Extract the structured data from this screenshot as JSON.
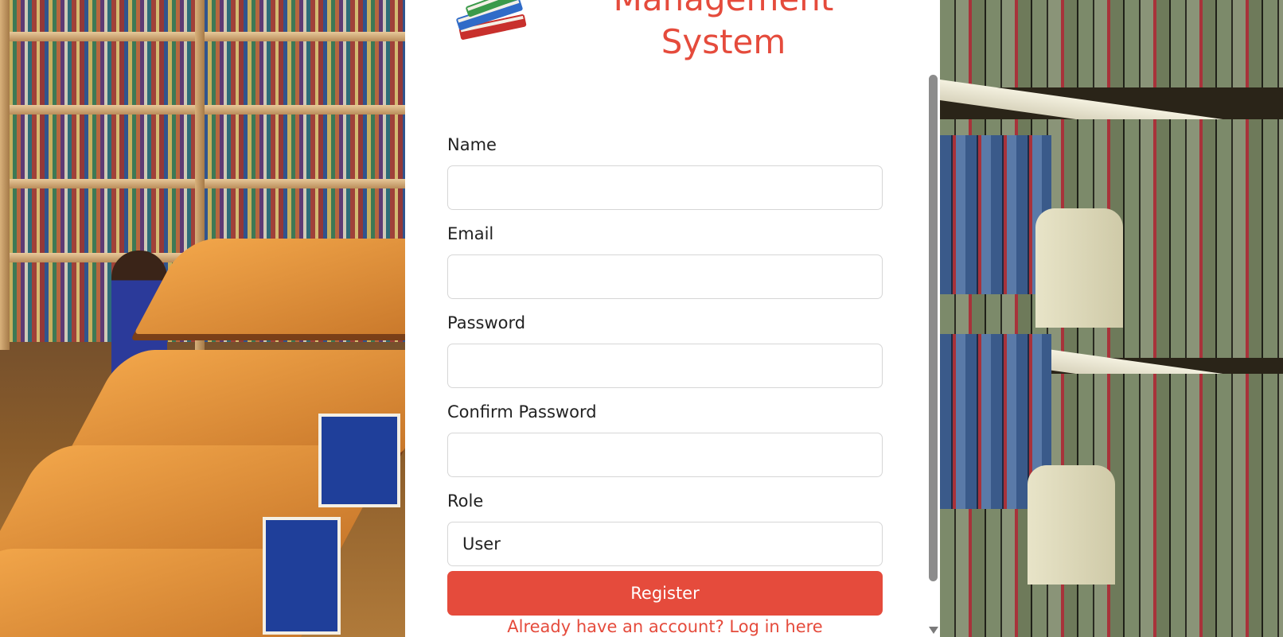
{
  "header": {
    "title_line1": "Management",
    "title_line2": "System"
  },
  "form": {
    "name_label": "Name",
    "name_value": "",
    "email_label": "Email",
    "email_value": "",
    "password_label": "Password",
    "password_value": "",
    "confirm_password_label": "Confirm Password",
    "confirm_password_value": "",
    "role_label": "Role",
    "role_selected": "User"
  },
  "actions": {
    "register_label": "Register",
    "login_link_label": "Already have an account? Log in here"
  },
  "colors": {
    "accent": "#e54b3c",
    "panel_background": "#ffffff"
  },
  "icons": {
    "logo": "books-stack-icon"
  }
}
